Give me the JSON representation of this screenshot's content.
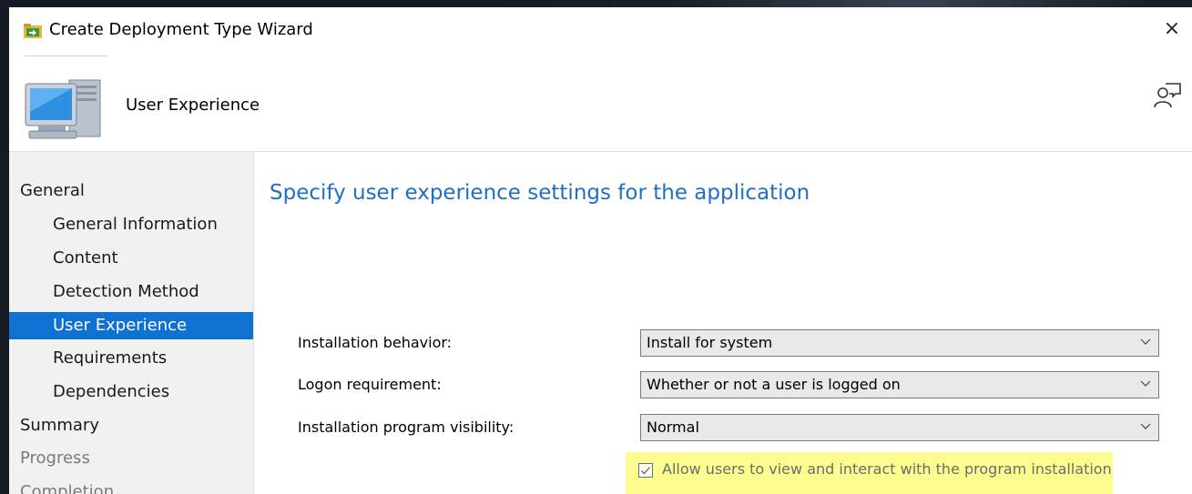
{
  "window": {
    "title": "Create Deployment Type Wizard",
    "close_glyph": "×"
  },
  "header": {
    "title": "User Experience",
    "icon": "computer-icon",
    "right_icon": "feedback-icon"
  },
  "sidebar": {
    "items": [
      {
        "label": "General",
        "level": "top",
        "state": "normal"
      },
      {
        "label": "General Information",
        "level": "sub",
        "state": "normal"
      },
      {
        "label": "Content",
        "level": "sub",
        "state": "normal"
      },
      {
        "label": "Detection Method",
        "level": "sub",
        "state": "normal"
      },
      {
        "label": "User Experience",
        "level": "sub",
        "state": "selected"
      },
      {
        "label": "Requirements",
        "level": "sub",
        "state": "normal"
      },
      {
        "label": "Dependencies",
        "level": "sub",
        "state": "normal"
      },
      {
        "label": "Summary",
        "level": "top",
        "state": "normal"
      },
      {
        "label": "Progress",
        "level": "top",
        "state": "disabled"
      },
      {
        "label": "Completion",
        "level": "top",
        "state": "disabled"
      }
    ]
  },
  "main": {
    "heading": "Specify user experience settings for the application",
    "fields": [
      {
        "label": "Installation behavior:",
        "value": "Install for system"
      },
      {
        "label": "Logon requirement:",
        "value": "Whether or not a user is logged on"
      },
      {
        "label": "Installation program visibility:",
        "value": "Normal"
      }
    ],
    "checkbox": {
      "label": "Allow users to view and interact with the program installation",
      "checked": true,
      "highlight_color": "#fdfc8e"
    }
  },
  "colors": {
    "accent": "#0f72d2",
    "heading": "#1f6fc5"
  }
}
